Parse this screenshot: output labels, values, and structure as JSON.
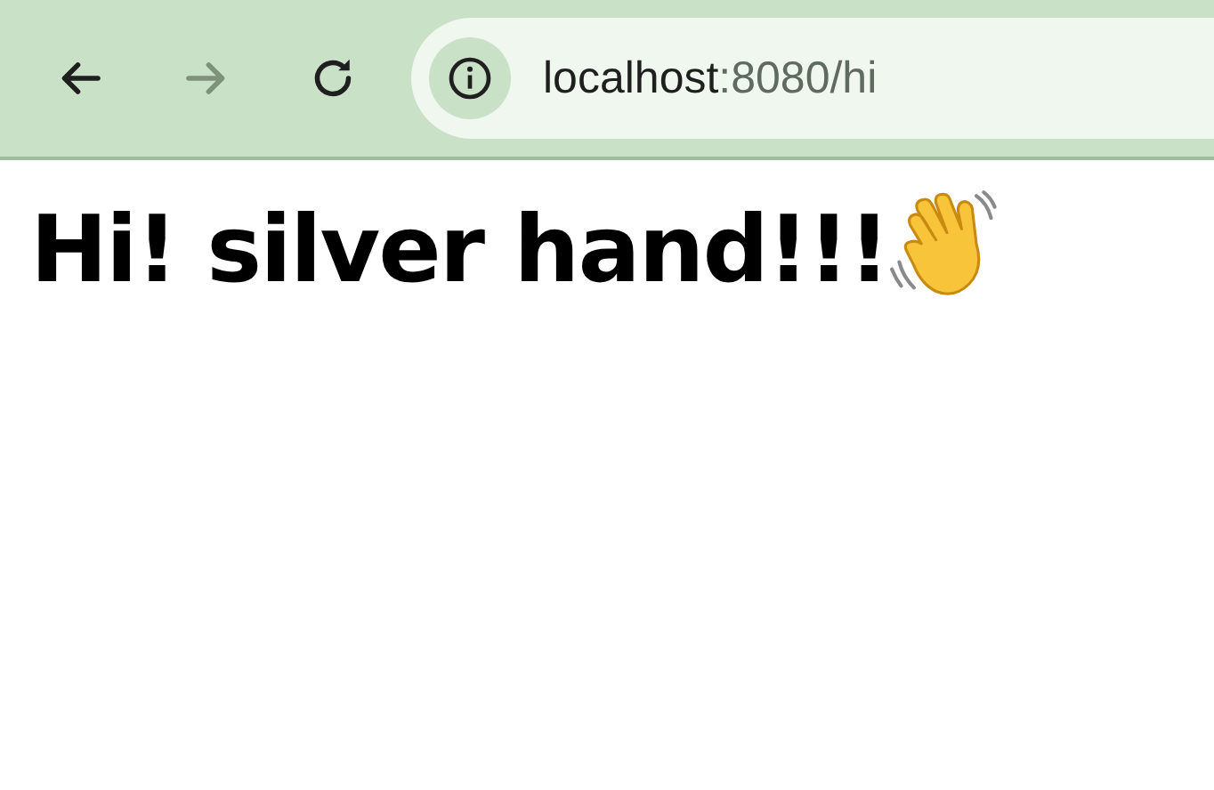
{
  "toolbar": {
    "buttons": [
      {
        "kind": "back",
        "disabled": false
      },
      {
        "kind": "forward",
        "disabled": true
      },
      {
        "kind": "reload",
        "disabled": false
      }
    ],
    "address": {
      "host": "localhost",
      "path": ":8080/hi"
    }
  },
  "page": {
    "heading": "Hi! silver hand!!!"
  }
}
